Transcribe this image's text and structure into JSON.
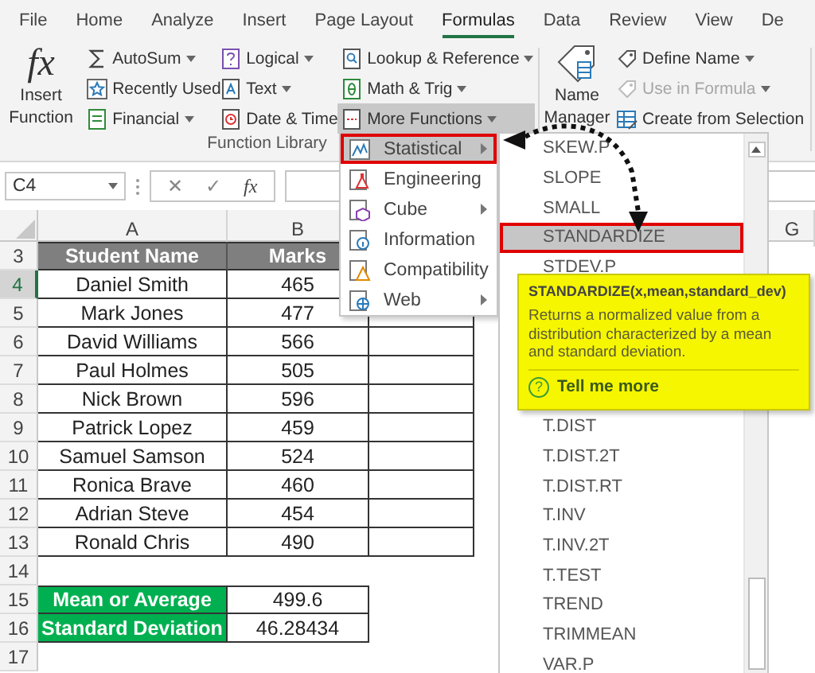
{
  "tabs": [
    {
      "label": "File",
      "selected": false
    },
    {
      "label": "Home",
      "selected": false
    },
    {
      "label": "Analyze",
      "selected": false
    },
    {
      "label": "Insert",
      "selected": false
    },
    {
      "label": "Page Layout",
      "selected": false
    },
    {
      "label": "Formulas",
      "selected": true
    },
    {
      "label": "Data",
      "selected": false
    },
    {
      "label": "Review",
      "selected": false
    },
    {
      "label": "View",
      "selected": false
    },
    {
      "label": "De",
      "selected": false
    }
  ],
  "ribbon": {
    "insert_function": {
      "glyph": "fx",
      "label": "Insert Function"
    },
    "library_columns": [
      [
        {
          "label": "AutoSum",
          "expanded": false
        },
        {
          "label": "Recently Used",
          "expanded": false
        },
        {
          "label": "Financial",
          "expanded": false
        }
      ],
      [
        {
          "label": "Logical",
          "expanded": false
        },
        {
          "label": "Text",
          "expanded": false
        },
        {
          "label": "Date & Time",
          "expanded": false
        }
      ],
      [
        {
          "label": "Lookup & Reference",
          "expanded": false
        },
        {
          "label": "Math & Trig",
          "expanded": false
        },
        {
          "label": "More Functions",
          "expanded": true
        }
      ]
    ],
    "group_label": "Function Library",
    "name_manager": "Name Manager",
    "defined_names": [
      {
        "label": "Define Name",
        "disabled": false
      },
      {
        "label": "Use in Formula",
        "disabled": true
      },
      {
        "label": "Create from Selection",
        "disabled": false
      }
    ]
  },
  "formula_bar": {
    "name_box": "C4",
    "cancel": "✕",
    "enter": "✓",
    "fx": "fx"
  },
  "sheet": {
    "columns": [
      "A",
      "B"
    ],
    "far_column": "G",
    "rows": [
      {
        "number": "3",
        "kind": "header",
        "selected": false,
        "cells": [
          "Student Name",
          "Marks"
        ]
      },
      {
        "number": "4",
        "kind": "data",
        "selected": true,
        "cells": [
          "Daniel Smith",
          "465"
        ]
      },
      {
        "number": "5",
        "kind": "data",
        "selected": false,
        "cells": [
          "Mark Jones",
          "477"
        ]
      },
      {
        "number": "6",
        "kind": "data",
        "selected": false,
        "cells": [
          "David Williams",
          "566"
        ]
      },
      {
        "number": "7",
        "kind": "data",
        "selected": false,
        "cells": [
          "Paul Holmes",
          "505"
        ]
      },
      {
        "number": "8",
        "kind": "data",
        "selected": false,
        "cells": [
          "Nick Brown",
          "596"
        ]
      },
      {
        "number": "9",
        "kind": "data",
        "selected": false,
        "cells": [
          "Patrick Lopez",
          "459"
        ]
      },
      {
        "number": "10",
        "kind": "data",
        "selected": false,
        "cells": [
          "Samuel Samson",
          "524"
        ]
      },
      {
        "number": "11",
        "kind": "data",
        "selected": false,
        "cells": [
          "Ronica Brave",
          "460"
        ]
      },
      {
        "number": "12",
        "kind": "data",
        "selected": false,
        "cells": [
          "Adrian Steve",
          "454"
        ]
      },
      {
        "number": "13",
        "kind": "data",
        "selected": false,
        "cells": [
          "Ronald Chris",
          "490"
        ]
      },
      {
        "number": "14",
        "kind": "blank",
        "selected": false
      },
      {
        "number": "15",
        "kind": "summary",
        "selected": false,
        "cells": [
          "Mean or Average",
          "499.6"
        ]
      },
      {
        "number": "16",
        "kind": "summary",
        "selected": false,
        "cells": [
          "Standard Deviation",
          "46.28434"
        ]
      },
      {
        "number": "17",
        "kind": "blank",
        "selected": false
      }
    ]
  },
  "function_menu": {
    "items": [
      {
        "label": "Statistical",
        "selected": true
      },
      {
        "label": "Engineering",
        "selected": false
      },
      {
        "label": "Cube",
        "selected": false
      },
      {
        "label": "Information",
        "selected": false
      },
      {
        "label": "Compatibility",
        "selected": false
      },
      {
        "label": "Web",
        "selected": false
      }
    ]
  },
  "function_list": {
    "top_items": [
      {
        "label": "SKEW.P",
        "selected": false
      },
      {
        "label": "SLOPE",
        "selected": false
      },
      {
        "label": "SMALL",
        "selected": false
      },
      {
        "label": "STANDARDIZE",
        "selected": true
      },
      {
        "label": "STDEV.P",
        "selected": false
      }
    ],
    "bottom_items": [
      {
        "label": "T.DIST",
        "selected": false
      },
      {
        "label": "T.DIST.2T",
        "selected": false
      },
      {
        "label": "T.DIST.RT",
        "selected": false
      },
      {
        "label": "T.INV",
        "selected": false
      },
      {
        "label": "T.INV.2T",
        "selected": false
      },
      {
        "label": "T.TEST",
        "selected": false
      },
      {
        "label": "TREND",
        "selected": false
      },
      {
        "label": "TRIMMEAN",
        "selected": false
      },
      {
        "label": "VAR.P",
        "selected": false
      }
    ]
  },
  "tooltip": {
    "signature": "STANDARDIZE(x,mean,standard_dev)",
    "description": "Returns a normalized value from a distribution characterized by a mean and standard deviation.",
    "help_glyph": "?",
    "link": "Tell me more"
  }
}
